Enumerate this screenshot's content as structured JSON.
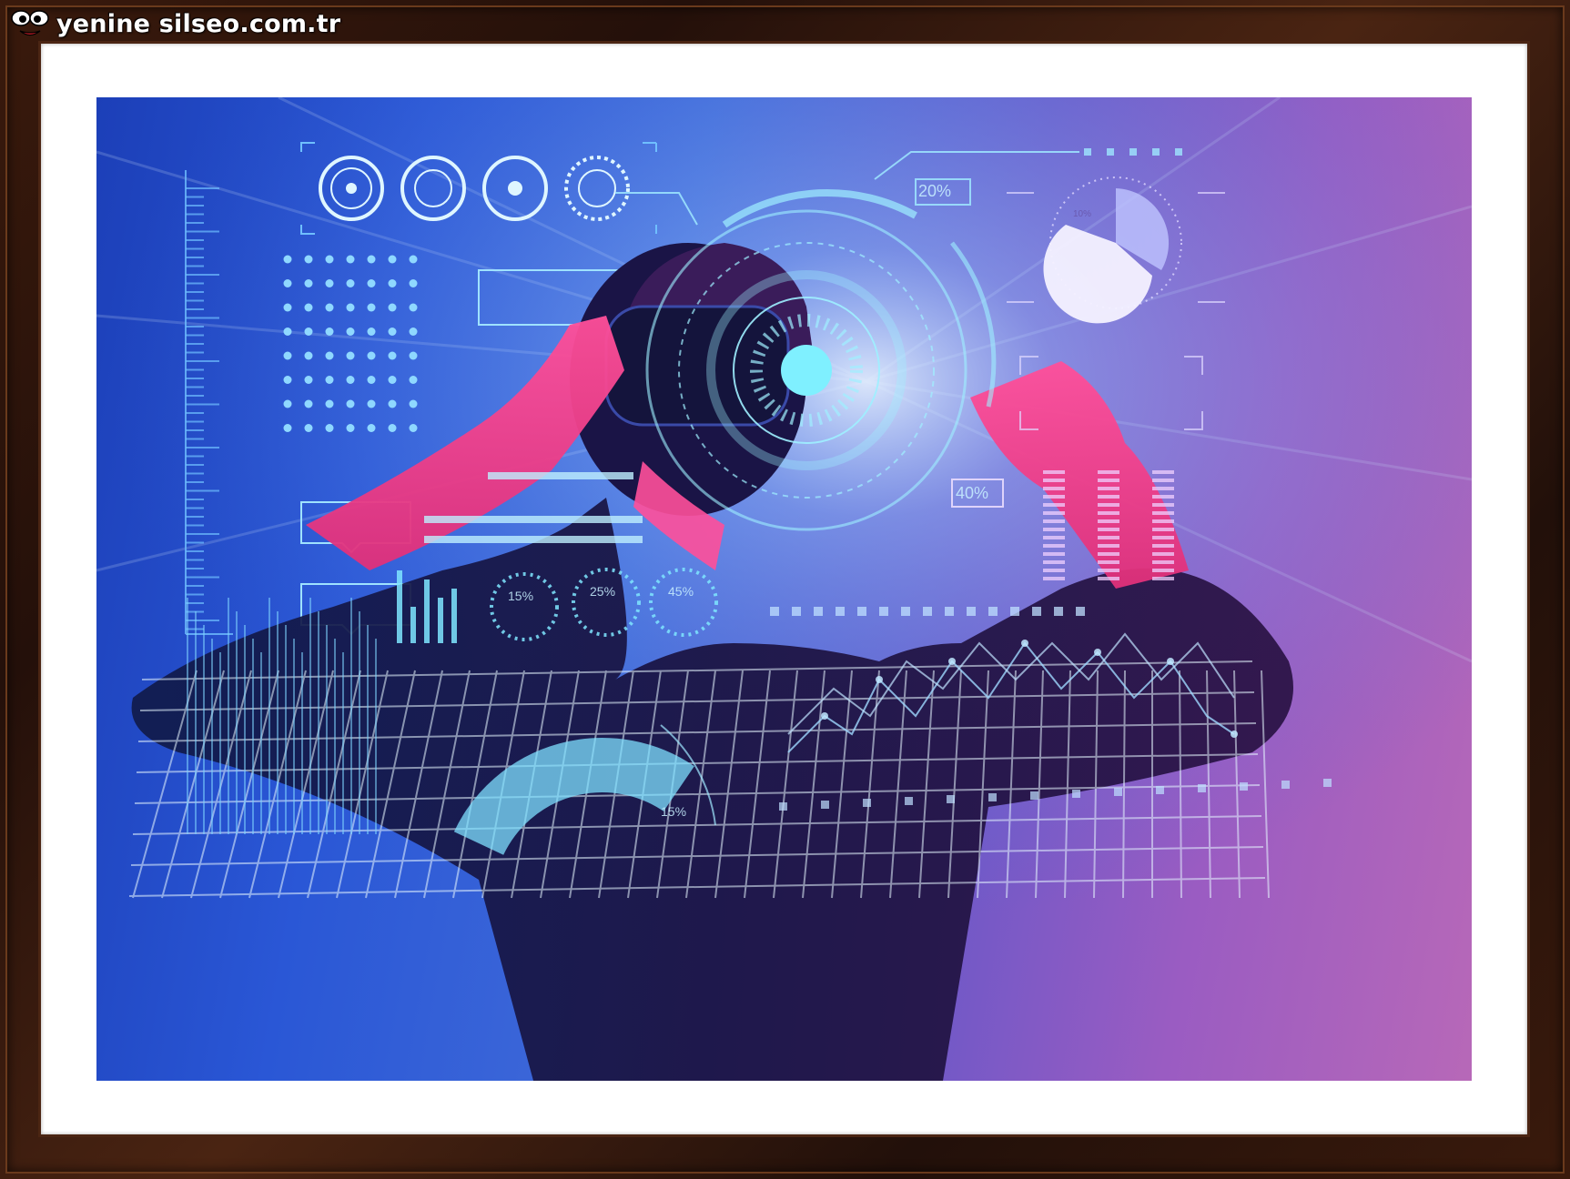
{
  "watermark": {
    "site": "yenine silseo.com.tr",
    "logo_icon": "cartoon-eyes-logo-icon"
  },
  "hud_labels": {
    "box_top": "20%",
    "box_mid": "40%",
    "pie_small": "10%",
    "ring_a": "15%",
    "ring_b": "25%",
    "ring_c": "45%",
    "gauge": "15%"
  },
  "colors": {
    "frame_wood": "#3a1a0c",
    "mat": "#ffffff",
    "blue": "#2a57d6",
    "magenta": "#ff3f8c",
    "cyan_hud": "#6fe6ff",
    "violet": "#9a5cc2"
  }
}
